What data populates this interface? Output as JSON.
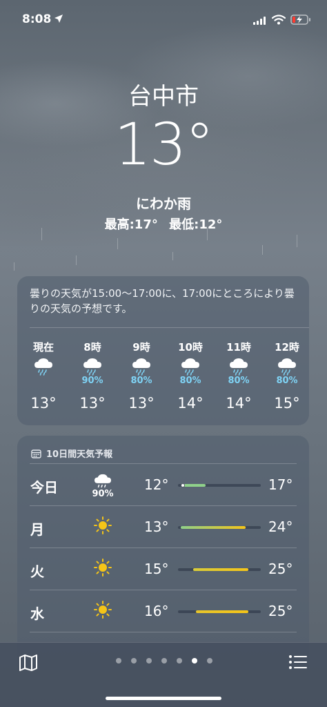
{
  "status_bar": {
    "time": "8:08"
  },
  "header": {
    "city": "台中市",
    "temperature": "13°",
    "condition": "にわか雨",
    "high": "最高:17°",
    "low": "最低:12°"
  },
  "hourly": {
    "summary": "曇りの天気が15:00～17:00に、17:00にところにより曇りの天気の予想です。",
    "items": [
      {
        "label": "現在",
        "icon": "rain-cloud-icon",
        "precip": "",
        "temp": "13°"
      },
      {
        "label": "8時",
        "icon": "rain-cloud-icon",
        "precip": "90%",
        "temp": "13°"
      },
      {
        "label": "9時",
        "icon": "rain-cloud-icon",
        "precip": "80%",
        "temp": "13°"
      },
      {
        "label": "10時",
        "icon": "rain-cloud-icon",
        "precip": "80%",
        "temp": "14°"
      },
      {
        "label": "11時",
        "icon": "rain-cloud-icon",
        "precip": "80%",
        "temp": "14°"
      },
      {
        "label": "12時",
        "icon": "rain-cloud-icon",
        "precip": "80%",
        "temp": "15°"
      }
    ]
  },
  "daily": {
    "header": "10日間天気予報",
    "days": [
      {
        "name": "今日",
        "icon": "rain-cloud-icon",
        "precip": "90%",
        "low": "12°",
        "high": "17°"
      },
      {
        "name": "月",
        "icon": "sun-icon",
        "precip": "",
        "low": "13°",
        "high": "24°"
      },
      {
        "name": "火",
        "icon": "sun-icon",
        "precip": "",
        "low": "15°",
        "high": "25°"
      },
      {
        "name": "水",
        "icon": "sun-icon",
        "precip": "",
        "low": "16°",
        "high": "25°"
      }
    ]
  },
  "page_dots": {
    "count": 7,
    "active_index": 5
  },
  "colors": {
    "precip_text": "#7fd3f5",
    "sun": "#f5c518",
    "bar_cool": "#8fd18a",
    "bar_warm": "#f5c518"
  }
}
